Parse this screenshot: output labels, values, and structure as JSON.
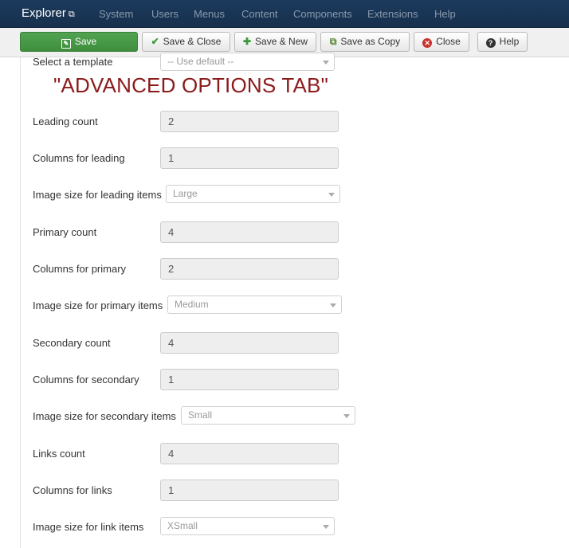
{
  "navbar": {
    "brand": "Explorer",
    "items": [
      "System",
      "Users",
      "Menus",
      "Content",
      "Components",
      "Extensions",
      "Help"
    ]
  },
  "toolbar": {
    "save": "Save",
    "save_close": "Save & Close",
    "save_new": "Save & New",
    "save_copy": "Save as Copy",
    "close": "Close",
    "help": "Help"
  },
  "form": {
    "template_label": "Select a template",
    "template_value": "-- Use default --",
    "overlay_title": "\"ADVANCED OPTIONS TAB\"",
    "fields": [
      {
        "label": "Leading count",
        "value": "2"
      },
      {
        "label": "Columns for leading",
        "value": "1"
      },
      {
        "label": "Image size for leading items",
        "value": "Large"
      },
      {
        "label": "Primary count",
        "value": "4"
      },
      {
        "label": "Columns for primary",
        "value": "2"
      },
      {
        "label": "Image size for primary items",
        "value": "Medium"
      },
      {
        "label": "Secondary count",
        "value": "4"
      },
      {
        "label": "Columns for secondary",
        "value": "1"
      },
      {
        "label": "Image size for secondary items",
        "value": "Small"
      },
      {
        "label": "Links count",
        "value": "4"
      },
      {
        "label": "Columns for links",
        "value": "1"
      },
      {
        "label": "Image size for link items",
        "value": "XSmall"
      }
    ]
  },
  "colors": {
    "navbar": "#1b3a5d",
    "save_button": "#51a351",
    "overlay_title": "#8b1a1a"
  }
}
